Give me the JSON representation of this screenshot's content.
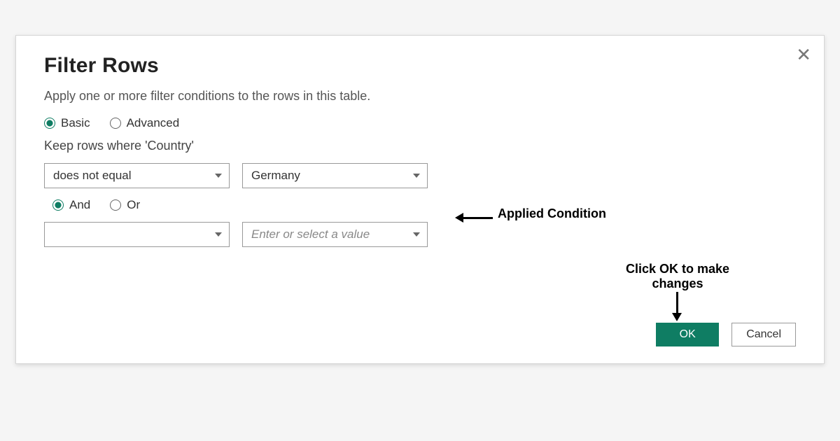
{
  "dialog": {
    "title": "Filter Rows",
    "subtitle": "Apply one or more filter conditions to the rows in this table.",
    "close_glyph": "✕",
    "mode": {
      "basic": "Basic",
      "advanced": "Advanced",
      "selected": "basic"
    },
    "keep_label": "Keep rows where 'Country'",
    "conditions": [
      {
        "operator": "does not equal",
        "value": "Germany"
      },
      {
        "operator": "",
        "value": "",
        "value_placeholder": "Enter or select a value"
      }
    ],
    "logic": {
      "and": "And",
      "or": "Or",
      "selected": "and"
    },
    "buttons": {
      "ok": "OK",
      "cancel": "Cancel"
    }
  },
  "annotations": {
    "applied_condition": "Applied Condition",
    "ok_note": "Click OK to make changes"
  }
}
